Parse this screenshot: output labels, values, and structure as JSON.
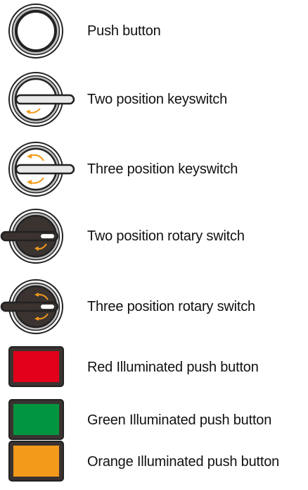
{
  "legend": {
    "items": [
      {
        "label": "Push button",
        "icon": "push-button-icon"
      },
      {
        "label": "Two position keyswitch",
        "icon": "two-position-keyswitch-icon"
      },
      {
        "label": "Three position keyswitch",
        "icon": "three-position-keyswitch-icon"
      },
      {
        "label": "Two position rotary switch",
        "icon": "two-position-rotary-switch-icon"
      },
      {
        "label": "Three position rotary switch",
        "icon": "three-position-rotary-switch-icon"
      },
      {
        "label": "Red Illuminated push button",
        "icon": "red-illuminated-button-icon"
      },
      {
        "label": "Green Illuminated push button",
        "icon": "green-illuminated-button-icon"
      },
      {
        "label": "Orange Illuminated push button",
        "icon": "orange-illuminated-button-icon"
      }
    ]
  },
  "colors": {
    "outline": "#222222",
    "bezel": "#bdbdbd",
    "knob_dark": "#3a3330",
    "arrow": "#f39a1b",
    "red": "#e3001b",
    "green": "#00953e",
    "orange": "#f39a1b"
  }
}
